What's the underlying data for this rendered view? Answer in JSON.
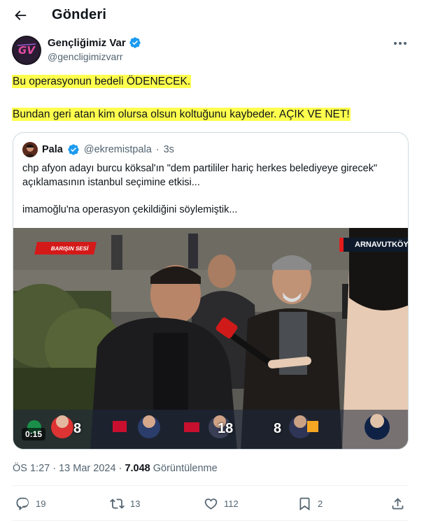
{
  "header": {
    "back_icon": "arrow-left-icon",
    "title": "Gönderi"
  },
  "post": {
    "author_name": "Gençliğimiz Var",
    "author_handle": "@gencligimizvarr",
    "verified_icon": "verified-badge-icon",
    "more_icon": "more-horizontal-icon",
    "line1": "Bu operasyonun bedeli ÖDENECEK.",
    "line2": "Bundan geri atan kim olursa olsun koltuğunu kaybeder. AÇIK VE NET!",
    "highlight_color": "#ffff4d"
  },
  "quote": {
    "author_name": "Pala",
    "author_handle": "@ekremistpala",
    "separator": "·",
    "time": "3s",
    "text1": "chp afyon adayı burcu köksal'ın \"dem partililer hariç herkes belediyeye girecek\" açıklamasının istanbul seçimine etkisi...",
    "text2": "imamoğlu'na operasyon çekildiğini söylemiştik...",
    "video": {
      "badge_left": "BARIŞIN SESİ",
      "badge_right": "ARNAVUTKÖY",
      "duration": "0:15",
      "poll_numbers": [
        "8",
        "18",
        "8"
      ],
      "party_label": "CHP"
    }
  },
  "meta": {
    "time": "ÖS 1:27",
    "dot": "·",
    "date": "13 Mar 2024",
    "views_count": "7.048",
    "views_label": "Görüntülenme"
  },
  "actions": {
    "reply_count": "19",
    "repost_count": "13",
    "like_count": "112",
    "bookmark_count": "2"
  },
  "colors": {
    "accent": "#1d9bf0",
    "text_secondary": "#536471",
    "border": "#cfd9de"
  }
}
